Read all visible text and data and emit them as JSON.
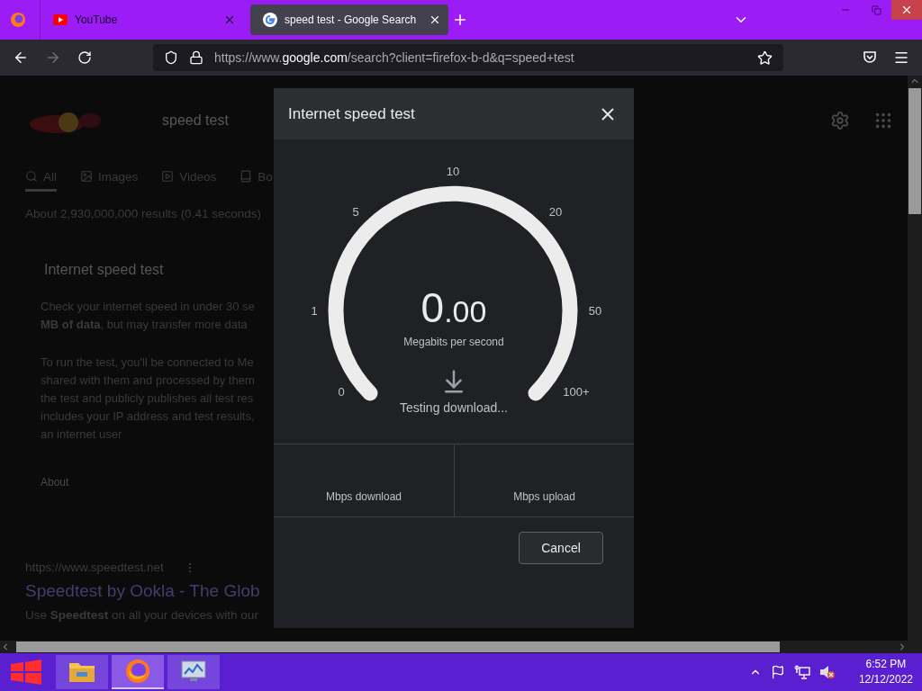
{
  "browser": {
    "tabs": [
      {
        "title": "YouTube",
        "selected": false
      },
      {
        "title": "speed test - Google Search",
        "selected": true
      }
    ],
    "url": {
      "scheme": "https://www.",
      "host": "google.com",
      "path": "/search?client=firefox-b-d&q=speed+test"
    }
  },
  "page": {
    "query": "speed test",
    "search_tabs": [
      {
        "label": "All",
        "selected": true
      },
      {
        "label": "Images",
        "selected": false
      },
      {
        "label": "Videos",
        "selected": false
      },
      {
        "label": "Bo",
        "selected": false
      }
    ],
    "result_stats": "About 2,930,000,000 results (0.41 seconds)",
    "card_title": "Internet speed test",
    "paragraphs": [
      [
        "Check your internet speed in under 30 se",
        "**MB of data**, but may transfer more data"
      ],
      [
        "To run the test, you'll be connected to Me",
        "shared with them and processed by them",
        "the test and publicly publishes all test res",
        "includes your IP address and test results,",
        "an internet user"
      ]
    ],
    "about_link": "About",
    "result": {
      "url": "https://www.speedtest.net",
      "title": "Speedtest by Ookla - The Glob",
      "snippet": "Use **Speedtest** on all your devices with our"
    }
  },
  "dialog": {
    "title": "Internet speed test",
    "scale": [
      "0",
      "1",
      "5",
      "10",
      "20",
      "50",
      "100+"
    ],
    "value_int": "0",
    "value_frac": ".00",
    "unit": "Megabits per second",
    "status": "Testing download...",
    "results": [
      "Mbps download",
      "Mbps upload"
    ],
    "cancel": "Cancel"
  },
  "taskbar": {
    "apps": [
      {
        "kind": "explorer",
        "selected": false
      },
      {
        "kind": "firefox",
        "selected": true
      },
      {
        "kind": "monitor",
        "selected": false
      }
    ],
    "time": "6:52 PM",
    "date": "12/12/2022"
  }
}
